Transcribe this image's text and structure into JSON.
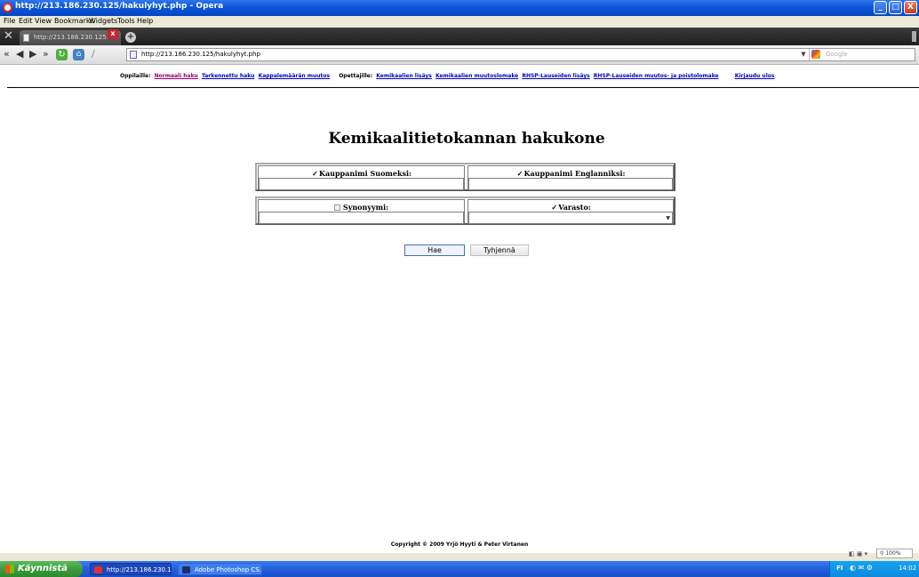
{
  "window": {
    "title": "http://213.186.230.125/hakulyhyt.php - Opera",
    "minimize": "_",
    "maximize": "□",
    "close": "X"
  },
  "menu": [
    "File",
    "Edit",
    "View",
    "Bookmarks",
    "Widgets",
    "Tools",
    "Help"
  ],
  "tab": {
    "label": "http://213.186.230.125...",
    "close": "x",
    "new_tab": "+"
  },
  "address": {
    "url": "http://213.186.230.125/hakulyhyt.php",
    "search_placeholder": "Google"
  },
  "nav": {
    "students_label": "Oppilaille:",
    "students_links": [
      "Normaali haku",
      "Tarkennettu haku",
      "Kappalemäärän muutos"
    ],
    "teachers_label": "Opettajille:",
    "teachers_links": [
      "Kemikaalien lisäys",
      "Kemikaalien muutoslomake",
      "RHSP-Lauseiden lisäys",
      "RHSP-Lauseiden muutos- ja poistolomake"
    ],
    "logout": "Kirjaudu ulos"
  },
  "page_title": "Kemikaalitietokannan hakukone",
  "fields": {
    "name_fi": {
      "label": "Kauppanimi Suomeksi:",
      "checked": true,
      "value": ""
    },
    "name_en": {
      "label": "Kauppanimi Englanniksi:",
      "checked": true,
      "value": ""
    },
    "synonym": {
      "label": "Synonyymi:",
      "checked": false,
      "value": ""
    },
    "storage": {
      "label": "Varasto:",
      "checked": true,
      "value": ""
    }
  },
  "buttons": {
    "search": "Hae",
    "clear": "Tyhjennä"
  },
  "copyright": "Copyright © 2009 Yrjö Hyyti & Peter Virtanen",
  "status": {
    "zoom": "100%"
  },
  "taskbar": {
    "start": "Käynnistä",
    "tasks": [
      "http://213.186.230.1...",
      "Adobe Photoshop CS..."
    ],
    "lang": "FI",
    "clock": "14:02"
  },
  "colors": {
    "link": "#0000cc",
    "visited_link": "#990066",
    "title_bar": "#0b55d8",
    "start_button": "#3a9a3a"
  }
}
